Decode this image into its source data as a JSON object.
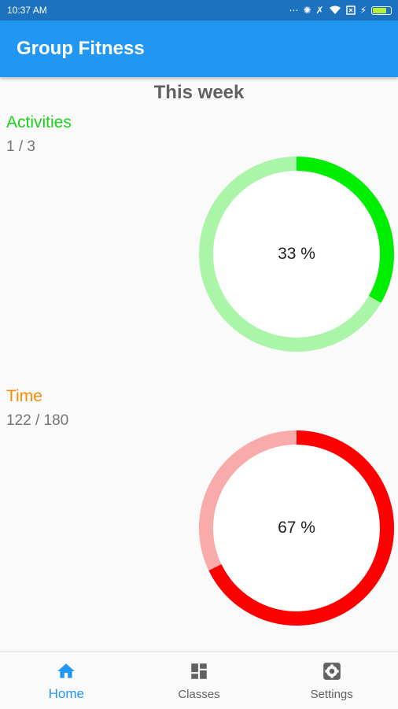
{
  "status_bar": {
    "time": "10:37 AM",
    "battery_color": "#b6f03a"
  },
  "app_bar": {
    "title": "Group Fitness",
    "color": "#2196f3"
  },
  "week_title": "This week",
  "sections": [
    {
      "label": "Activities",
      "value_text": "1 / 3",
      "percent_text": "33 %",
      "progress": 0.333,
      "label_color": "#1bd11b",
      "progress_color": "#00ee00",
      "track_color": "#aaf5a8"
    },
    {
      "label": "Time",
      "value_text": "122 / 180",
      "percent_text": "67 %",
      "progress": 0.678,
      "label_color": "#fb8c00",
      "progress_color": "#ff0000",
      "track_color": "#f9aaaa"
    }
  ],
  "bottom_nav": {
    "items": [
      {
        "label": "Home",
        "icon": "home-icon",
        "active": true
      },
      {
        "label": "Classes",
        "icon": "dashboard-icon",
        "active": false
      },
      {
        "label": "Settings",
        "icon": "settings-icon",
        "active": false
      }
    ],
    "active_color": "#2196f3",
    "inactive_color": "#616161"
  }
}
